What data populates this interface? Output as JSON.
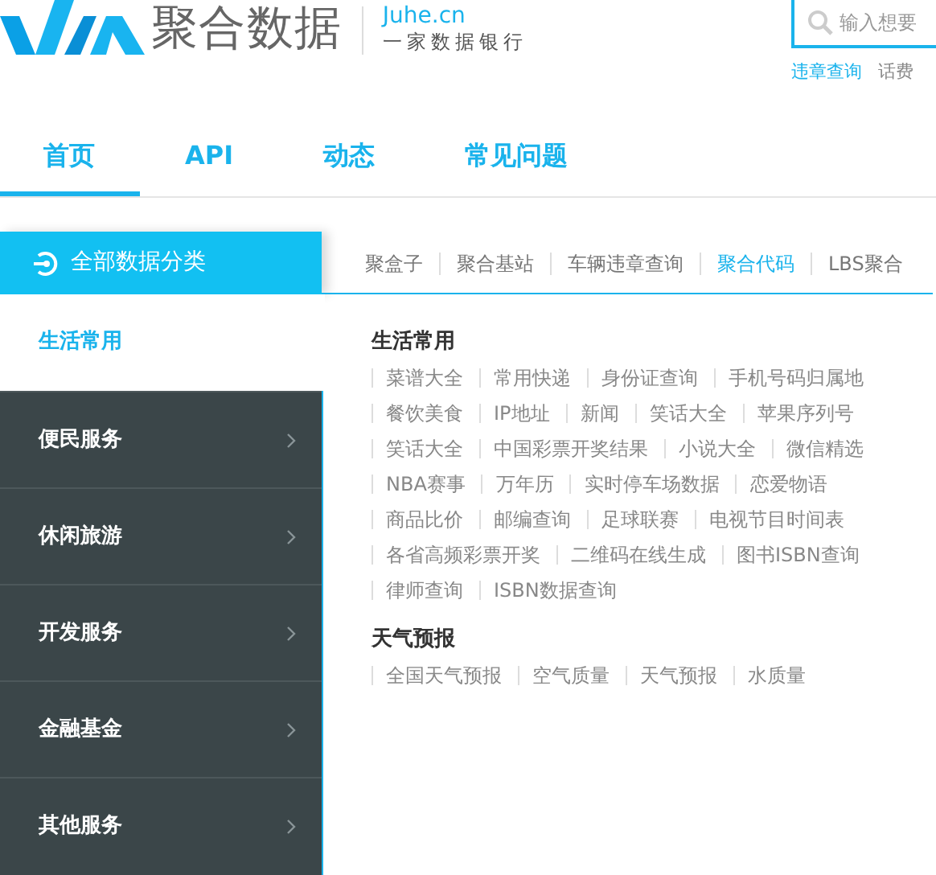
{
  "header": {
    "brand": "聚合数据",
    "domain": "Juhe.cn",
    "slogan": "一家数据银行",
    "search": {
      "placeholder": "输入想要"
    },
    "quick_links": [
      {
        "label": "违章查询",
        "selected": true
      },
      {
        "label": "话费",
        "selected": false
      }
    ]
  },
  "nav": [
    {
      "label": "首页",
      "selected": true
    },
    {
      "label": "API",
      "selected": false
    },
    {
      "label": "动态",
      "selected": false
    },
    {
      "label": "常见问题",
      "selected": false
    }
  ],
  "category_button": "全部数据分类",
  "sub_links": [
    {
      "label": "聚盒子",
      "selected": false
    },
    {
      "label": "聚合基站",
      "selected": false
    },
    {
      "label": "车辆违章查询",
      "selected": false
    },
    {
      "label": "聚合代码",
      "selected": true
    },
    {
      "label": "LBS聚合",
      "selected": false
    }
  ],
  "sidebar": [
    {
      "label": "生活常用",
      "selected": true
    },
    {
      "label": "便民服务",
      "selected": false
    },
    {
      "label": "休闲旅游",
      "selected": false
    },
    {
      "label": "开发服务",
      "selected": false
    },
    {
      "label": "金融基金",
      "selected": false
    },
    {
      "label": "其他服务",
      "selected": false
    }
  ],
  "sections": [
    {
      "title": "生活常用",
      "rows": [
        [
          "菜谱大全",
          "常用快递",
          "身份证查询",
          "手机号码归属地"
        ],
        [
          "餐饮美食",
          "IP地址",
          "新闻",
          "笑话大全",
          "苹果序列号"
        ],
        [
          "笑话大全",
          "中国彩票开奖结果",
          "小说大全",
          "微信精选"
        ],
        [
          "NBA赛事",
          "万年历",
          "实时停车场数据",
          "恋爱物语"
        ],
        [
          "商品比价",
          "邮编查询",
          "足球联赛",
          "电视节目时间表"
        ],
        [
          "各省高频彩票开奖",
          "二维码在线生成",
          "图书ISBN查询"
        ],
        [
          "律师查询",
          "ISBN数据查询"
        ]
      ]
    },
    {
      "title": "天气预报",
      "rows": [
        [
          "全国天气预报",
          "空气质量",
          "天气预报",
          "水质量"
        ]
      ]
    }
  ]
}
